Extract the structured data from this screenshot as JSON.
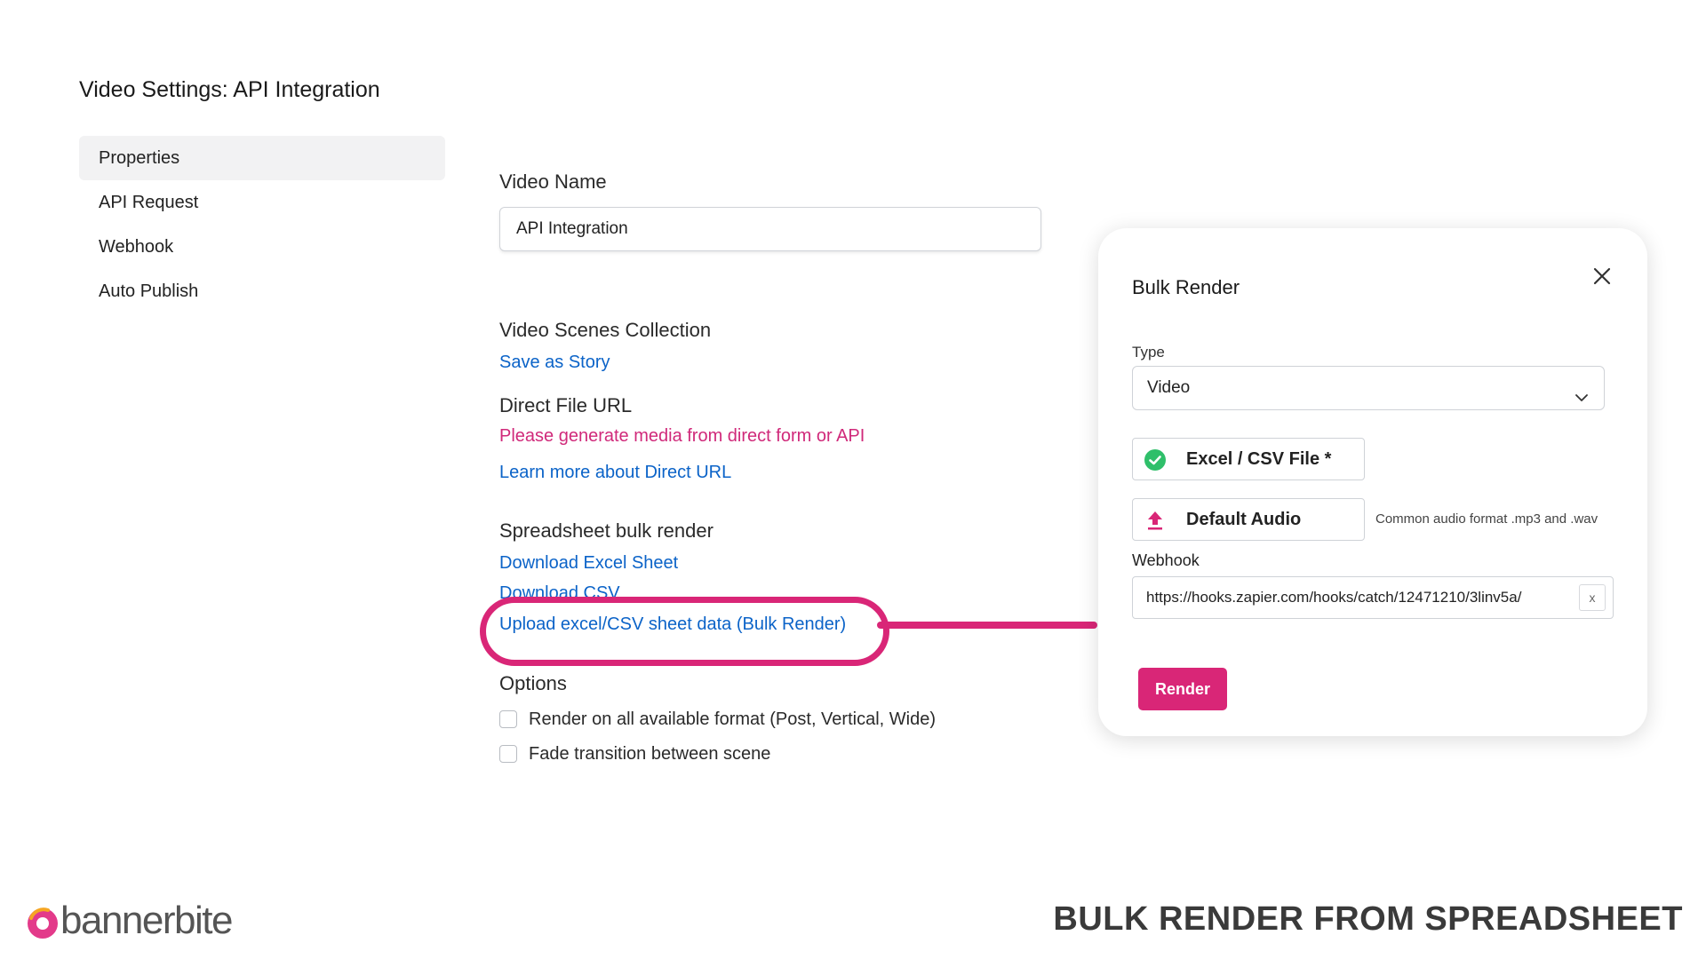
{
  "page_title": "Video Settings: API Integration",
  "sidebar": {
    "items": [
      {
        "label": "Properties",
        "active": true
      },
      {
        "label": "API Request",
        "active": false
      },
      {
        "label": "Webhook",
        "active": false
      },
      {
        "label": "Auto Publish",
        "active": false
      }
    ]
  },
  "main": {
    "video_name_label": "Video Name",
    "video_name_value": "API Integration",
    "scenes_label": "Video Scenes Collection",
    "save_story_link": "Save as Story",
    "direct_url_label": "Direct File URL",
    "direct_url_warning": "Please generate media from direct form or API",
    "direct_url_learn": "Learn more about Direct URL",
    "bulk_label": "Spreadsheet bulk render",
    "download_excel": "Download Excel Sheet",
    "download_csv": "Download CSV",
    "upload_link": "Upload excel/CSV sheet data (Bulk Render)",
    "options_label": "Options",
    "option_all_formats": "Render on all available format (Post, Vertical, Wide)",
    "option_fade": "Fade transition between scene"
  },
  "modal": {
    "title": "Bulk Render",
    "type_label": "Type",
    "type_value": "Video",
    "file_button": "Excel / CSV File *",
    "audio_button": "Default Audio",
    "audio_hint": "Common audio format .mp3 and .wav",
    "webhook_label": "Webhook",
    "webhook_value": "https://hooks.zapier.com/hooks/catch/12471210/3linv5a/",
    "clear_label": "x",
    "render_button": "Render"
  },
  "branding": {
    "logo_text": "bannerbite",
    "caption": "BULK RENDER FROM SPREADSHEET"
  },
  "colors": {
    "accent": "#d92677",
    "link": "#0b63c8",
    "success": "#2fbf6a"
  }
}
